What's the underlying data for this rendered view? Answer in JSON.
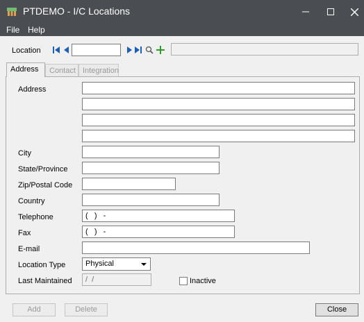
{
  "window": {
    "title": "PTDEMO - I/C Locations"
  },
  "menu": {
    "file": "File",
    "help": "Help"
  },
  "location": {
    "label": "Location",
    "code": "",
    "description": ""
  },
  "tabs": [
    {
      "label": "Address",
      "active": true
    },
    {
      "label": "Contact",
      "active": false
    },
    {
      "label": "Integration",
      "active": false
    }
  ],
  "form": {
    "address_label": "Address",
    "address_lines": [
      "",
      "",
      "",
      ""
    ],
    "city_label": "City",
    "city": "",
    "state_label": "State/Province",
    "state": "",
    "zip_label": "Zip/Postal Code",
    "zip": "",
    "country_label": "Country",
    "country": "",
    "telephone_label": "Telephone",
    "telephone": "(   )   -",
    "fax_label": "Fax",
    "fax": "(   )   -",
    "email_label": "E-mail",
    "email": "",
    "location_type_label": "Location Type",
    "location_type": "Physical",
    "last_maintained_label": "Last Maintained",
    "last_maintained": "/  /",
    "inactive_label": "Inactive",
    "inactive": false
  },
  "buttons": {
    "add": "Add",
    "delete": "Delete",
    "close": "Close"
  },
  "icons": {
    "first": "first-record-icon",
    "prev": "previous-record-icon",
    "next": "next-record-icon",
    "last": "last-record-icon",
    "lookup": "lookup-icon",
    "add": "add-icon"
  },
  "colors": {
    "titlebar": "#4a4d52",
    "accent_green": "#2e9b2e",
    "nav_blue": "#1a5fb4"
  }
}
